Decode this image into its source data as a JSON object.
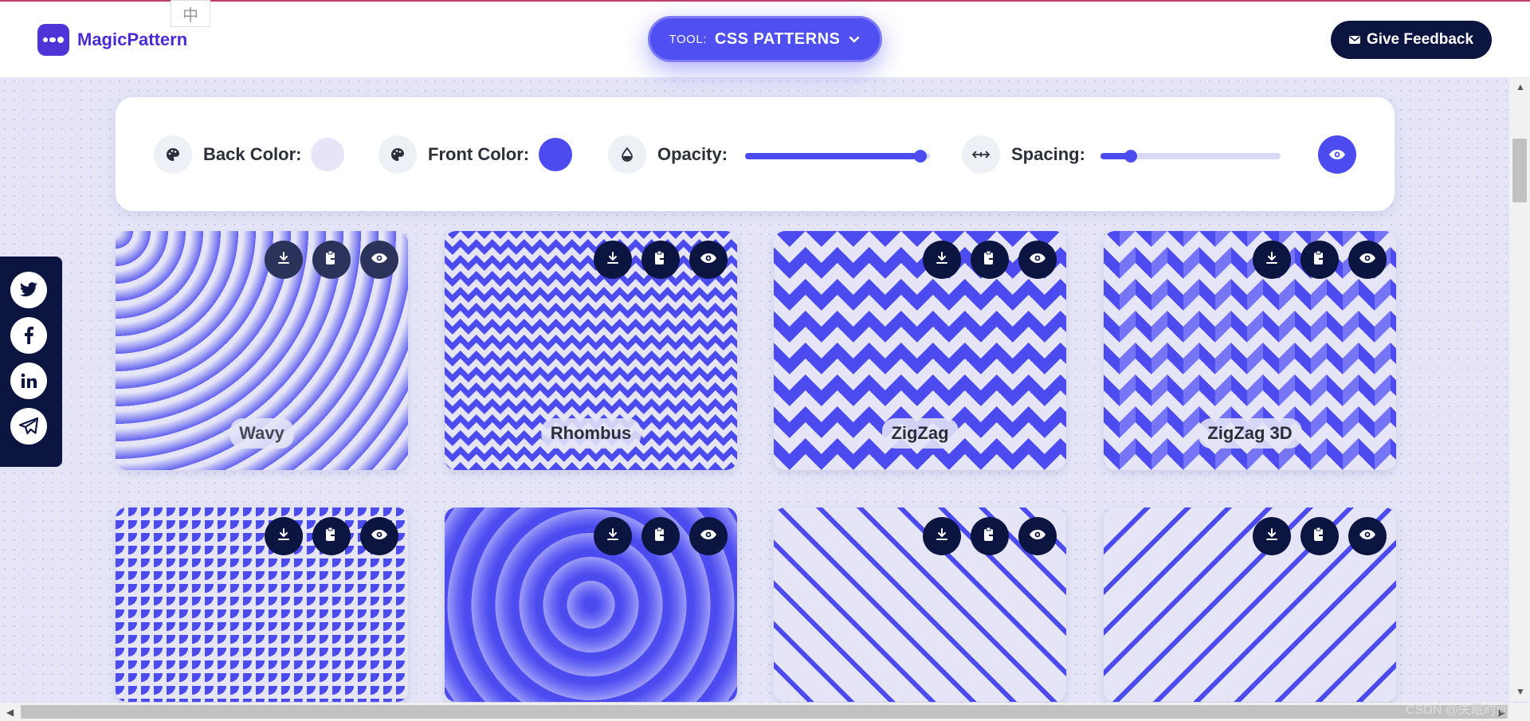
{
  "header": {
    "brand": "MagicPattern",
    "lang_badge": "中",
    "tool_prefix": "TOOL:",
    "tool_name": "CSS PATTERNS",
    "feedback_label": "Give Feedback"
  },
  "controls": {
    "back_color_label": "Back Color:",
    "back_color_value": "#e5e5f7",
    "front_color_label": "Front Color:",
    "front_color_value": "#4b4bf0",
    "opacity_label": "Opacity:",
    "opacity_value": 0.95,
    "spacing_label": "Spacing:",
    "spacing_value": 0.17
  },
  "social": [
    "twitter-icon",
    "facebook-icon",
    "linkedin-icon",
    "telegram-icon"
  ],
  "patterns": [
    {
      "label": "Wavy"
    },
    {
      "label": "Rhombus"
    },
    {
      "label": "ZigZag"
    },
    {
      "label": "ZigZag 3D"
    },
    {
      "label": ""
    },
    {
      "label": ""
    },
    {
      "label": ""
    },
    {
      "label": ""
    }
  ],
  "watermark": "CSDN @失眠时间",
  "colors": {
    "accent": "#4b4bf0",
    "dark": "#0c1440",
    "background": "#e5e5f7",
    "brand": "#4b2cd4"
  }
}
